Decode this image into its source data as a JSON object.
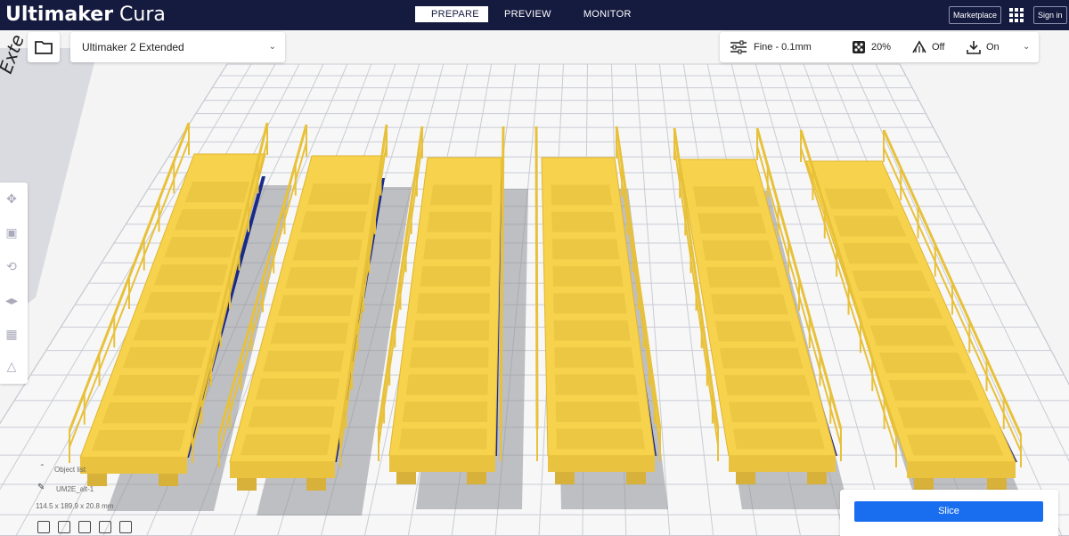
{
  "app": {
    "title_bold": "Ultimaker",
    "title_light": "Cura"
  },
  "stages": [
    {
      "label": "PREPARE",
      "active": true
    },
    {
      "label": "PREVIEW",
      "active": false
    },
    {
      "label": "MONITOR",
      "active": false
    }
  ],
  "header": {
    "marketplace_label": "Marketplace",
    "signin_label": "Sign in"
  },
  "printer": {
    "name": "Ultimaker 2 Extended"
  },
  "print_settings": {
    "profile": "Fine - 0.1mm",
    "infill": "20%",
    "support": "Off",
    "adhesion": "On"
  },
  "object_list": {
    "header": "Object list",
    "object_name": "UM2E_alt-1",
    "dimensions": "114.5 x 189.9 x 20.8 mm"
  },
  "actions": {
    "slice_label": "Slice"
  },
  "colors": {
    "header_bg": "#151a3f",
    "model_yellow": "#f7d24c",
    "slice_blue": "#196ef0",
    "grid": "#c9ccd3"
  },
  "scene": {
    "model_count": 6,
    "build_plate_text": "Exte"
  }
}
